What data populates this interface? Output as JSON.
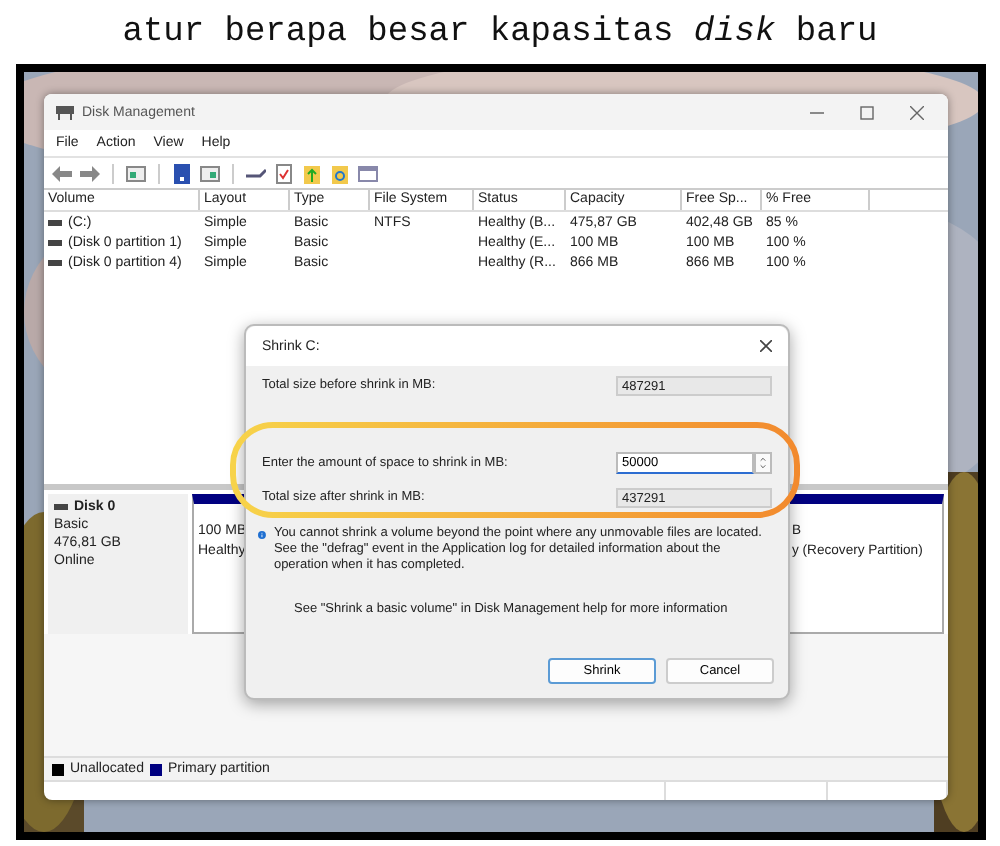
{
  "caption": "atur berapa besar kapasitas *disk* baru",
  "window": {
    "title": "Disk Management"
  },
  "menu": [
    "File",
    "Action",
    "View",
    "Help"
  ],
  "volumes": {
    "columns": [
      "Volume",
      "Layout",
      "Type",
      "File System",
      "Status",
      "Capacity",
      "Free Sp...",
      "% Free"
    ],
    "rows": [
      {
        "cells": [
          "(C:)",
          "Simple",
          "Basic",
          "NTFS",
          "Healthy (B...",
          "475,87 GB",
          "402,48 GB",
          "85 %"
        ]
      },
      {
        "cells": [
          "(Disk 0 partition 1)",
          "Simple",
          "Basic",
          "",
          "Healthy (E...",
          "100 MB",
          "100 MB",
          "100 %"
        ]
      },
      {
        "cells": [
          "(Disk 0 partition 4)",
          "Simple",
          "Basic",
          "",
          "Healthy (R...",
          "866 MB",
          "866 MB",
          "100 %"
        ]
      }
    ]
  },
  "disk": {
    "name": "Disk 0",
    "type": "Basic",
    "size": "476,81 GB",
    "status": "Online",
    "partitions": [
      {
        "size": "100 MB",
        "status": "Healthy"
      },
      {
        "size": "B",
        "status": "y (Recovery Partition)"
      }
    ]
  },
  "legend": [
    {
      "label": "Unallocated",
      "color": "#000000"
    },
    {
      "label": "Primary partition",
      "color": "#000080"
    }
  ],
  "dialog": {
    "title": "Shrink C:",
    "fields": [
      {
        "label": "Total size before shrink in MB:",
        "value": "487291",
        "kind": "readonly"
      },
      {
        "label": "Enter the amount of space to shrink in MB:",
        "value": "50000",
        "kind": "spinner"
      },
      {
        "label": "Total size after shrink in MB:",
        "value": "437291",
        "kind": "readonly"
      }
    ],
    "info": "You cannot shrink a volume beyond the point where any unmovable files are located. See the \"defrag\" event in the Application log for detailed information about the operation when it has completed.",
    "help": "See \"Shrink a basic volume\" in Disk Management help for more information",
    "buttons": [
      {
        "label": "Shrink",
        "default": true
      },
      {
        "label": "Cancel",
        "default": false
      }
    ]
  }
}
